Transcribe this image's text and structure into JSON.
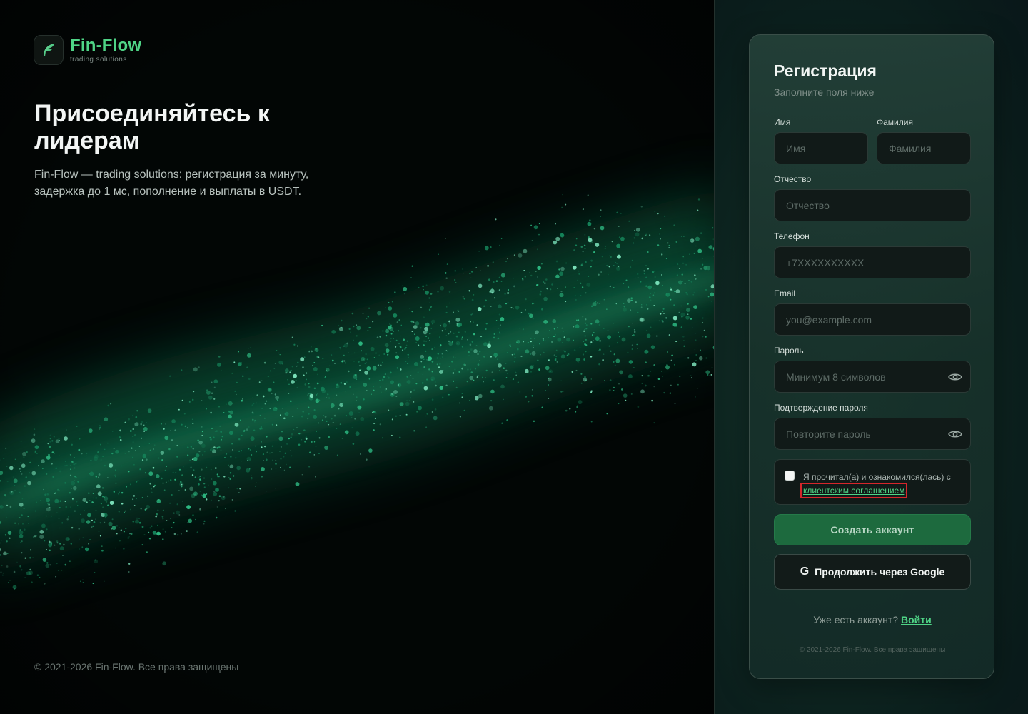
{
  "brand": {
    "name": "Fin-Flow",
    "tagline": "trading solutions",
    "accent_color": "#4fd486",
    "logo_icon": "leaf-f-icon"
  },
  "hero": {
    "title": "Присоединяйтесь к лидерам",
    "description": "Fin-Flow — trading solutions: регистрация за минуту, задержка до 1 мс, пополнение и выплаты в USDT.",
    "copyright": "© 2021-2026 Fin-Flow. Все права защищены"
  },
  "form": {
    "title": "Регистрация",
    "subtitle": "Заполните поля ниже",
    "first_name": {
      "label": "Имя",
      "placeholder": "Имя",
      "value": ""
    },
    "last_name": {
      "label": "Фамилия",
      "placeholder": "Фамилия",
      "value": ""
    },
    "middle_name": {
      "label": "Отчество",
      "placeholder": "Отчество",
      "value": ""
    },
    "phone": {
      "label": "Телефон",
      "placeholder": "+7XXXXXXXXXX",
      "value": ""
    },
    "email": {
      "label": "Email",
      "placeholder": "you@example.com",
      "value": ""
    },
    "password": {
      "label": "Пароль",
      "placeholder": "Минимум 8 символов",
      "value": "",
      "toggle_icon": "eye-icon"
    },
    "password_confirm": {
      "label": "Подтверждение пароля",
      "placeholder": "Повторите пароль",
      "value": "",
      "toggle_icon": "eye-icon"
    },
    "consent": {
      "checked": false,
      "text": "Я прочитал(а) и ознакомился(лась) с",
      "link_text": "клиентским соглашением",
      "suffix": "."
    },
    "submit_label": "Создать аккаунт",
    "google_icon": "G",
    "google_label": "Продолжить через Google",
    "login_prompt": "Уже есть аккаунт?",
    "login_link": "Войти",
    "copyright": "© 2021-2026 Fin-Flow. Все права защищены"
  }
}
